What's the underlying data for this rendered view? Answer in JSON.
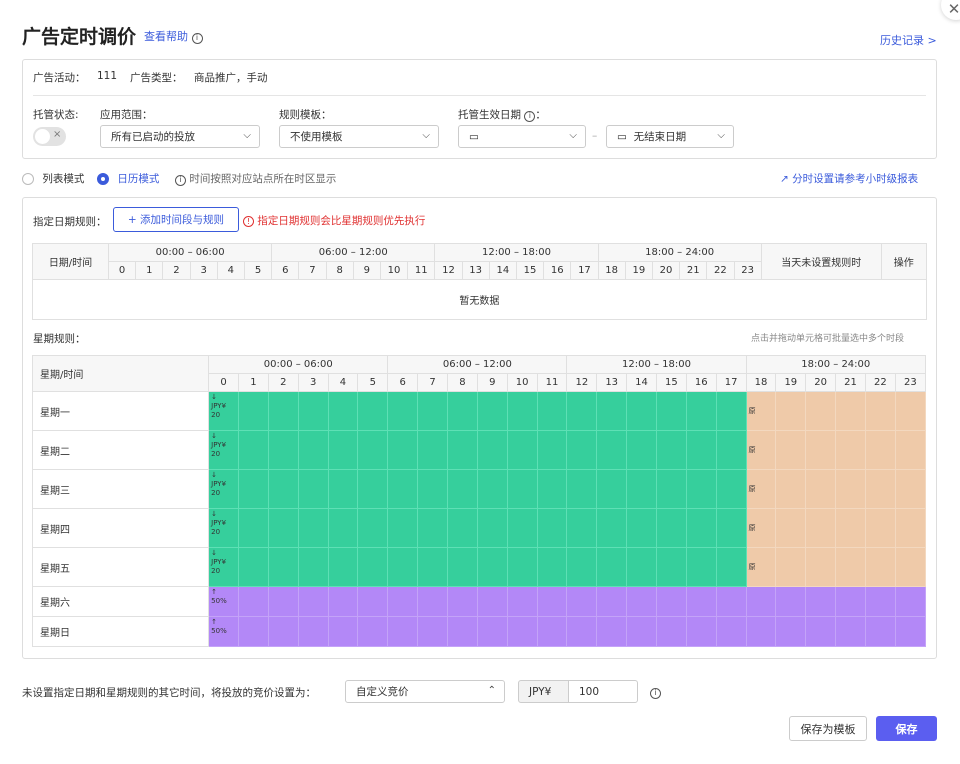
{
  "dialog": {
    "title": "广告定时调价",
    "help_link": "查看帮助",
    "history_link": "历史记录 >",
    "close_icon": "✕"
  },
  "info": {
    "activity_label": "广告活动：",
    "activity_value": "111",
    "type_label": "广告类型：",
    "type_value": "商品推广，手动"
  },
  "settings": {
    "hosting_label": "托管状态:",
    "scope_label": "应用范围：",
    "scope_value": "所有已启动的投放",
    "template_label": "规则模板：",
    "template_value": "不使用模板",
    "date_label": "托管生效日期",
    "date_suffix": "：",
    "date_start": "",
    "date_end": "无结束日期",
    "date_sep": "–"
  },
  "modes": {
    "list": "列表模式",
    "calendar": "日历模式",
    "timezone_note": "时间按照对应站点所在时区显示",
    "reference_link": "分时设置请参考小时级报表"
  },
  "date_rules": {
    "label": "指定日期规则：",
    "add_button": "+ 添加时间段与规则",
    "warning": "指定日期规则会比星期规则优先执行",
    "col_datetime": "日期/时间",
    "col_no_rule": "当天未设置规则时",
    "col_ops": "操作",
    "empty": "暂无数据"
  },
  "time_ranges": [
    "00:00 – 06:00",
    "06:00 – 12:00",
    "12:00 – 18:00",
    "18:00 – 24:00"
  ],
  "hours": [
    "0",
    "1",
    "2",
    "3",
    "4",
    "5",
    "6",
    "7",
    "8",
    "9",
    "10",
    "11",
    "12",
    "13",
    "14",
    "15",
    "16",
    "17",
    "18",
    "19",
    "20",
    "21",
    "22",
    "23"
  ],
  "week_rules": {
    "label": "星期规则：",
    "hint": "点击并拖动单元格可批量选中多个时段",
    "col_header": "星期/时间",
    "days": [
      {
        "name": "星期一",
        "arrow": "↓",
        "cur": "JPY¥",
        "amt": "20",
        "mark": "原"
      },
      {
        "name": "星期二",
        "arrow": "↓",
        "cur": "JPY¥",
        "amt": "20",
        "mark": "原"
      },
      {
        "name": "星期三",
        "arrow": "↓",
        "cur": "JPY¥",
        "amt": "20",
        "mark": "原"
      },
      {
        "name": "星期四",
        "arrow": "↓",
        "cur": "JPY¥",
        "amt": "20",
        "mark": "原"
      },
      {
        "name": "星期五",
        "arrow": "↓",
        "cur": "JPY¥",
        "amt": "20",
        "mark": "原"
      },
      {
        "name": "星期六",
        "arrow": "↑",
        "cur": "",
        "amt": "50%",
        "mark": ""
      },
      {
        "name": "星期日",
        "arrow": "↑",
        "cur": "",
        "amt": "50%",
        "mark": ""
      }
    ]
  },
  "footer": {
    "label": "未设置指定日期和星期规则的其它时间，将投放的竞价设置为：",
    "bid_type": "自定义竞价",
    "currency": "JPY¥",
    "amount": "100",
    "save_template": "保存为模板",
    "save": "保存"
  },
  "colors": {
    "accent": "#3b5bdb",
    "green": "#36cf9c",
    "orange": "#efcaa9",
    "purple": "#b388f7",
    "warning": "#e03131"
  }
}
